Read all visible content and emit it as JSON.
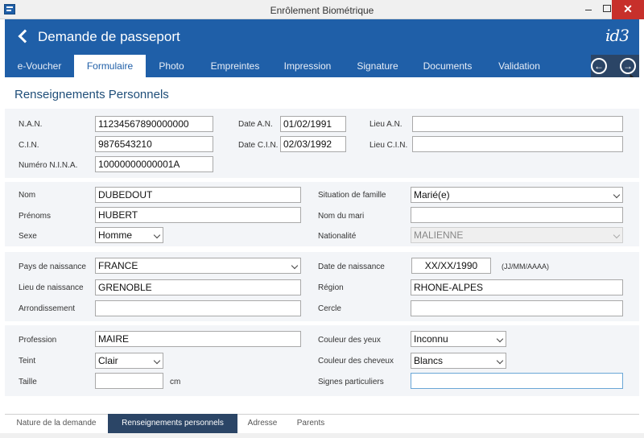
{
  "window": {
    "title": "Enrôlement Biométrique",
    "close_glyph": "✕"
  },
  "header": {
    "title": "Demande de passeport",
    "logo": "id3"
  },
  "tabs": [
    "e-Voucher",
    "Formulaire",
    "Photo",
    "Empreintes",
    "Impression",
    "Signature",
    "Documents",
    "Validation"
  ],
  "active_tab": "Formulaire",
  "nav": {
    "prev_glyph": "←",
    "next_glyph": "→"
  },
  "section_title": "Renseignements Personnels",
  "ids": {
    "nan": {
      "label": "N.A.N.",
      "value": "11234567890000000"
    },
    "cin": {
      "label": "C.I.N.",
      "value": "9876543210"
    },
    "nina": {
      "label": "Numéro N.I.N.A.",
      "value": "10000000000001A"
    },
    "date_an": {
      "label": "Date A.N.",
      "value": "01/02/1991"
    },
    "date_cin": {
      "label": "Date C.I.N.",
      "value": "02/03/1992"
    },
    "lieu_an": {
      "label": "Lieu A.N.",
      "value": ""
    },
    "lieu_cin": {
      "label": "Lieu C.I.N.",
      "value": ""
    }
  },
  "identity": {
    "nom": {
      "label": "Nom",
      "value": "DUBEDOUT"
    },
    "prenoms": {
      "label": "Prénoms",
      "value": "HUBERT"
    },
    "sexe": {
      "label": "Sexe",
      "value": "Homme"
    },
    "situation": {
      "label": "Situation de famille",
      "value": "Marié(e)"
    },
    "nom_mari": {
      "label": "Nom du mari",
      "value": ""
    },
    "nationalite": {
      "label": "Nationalité",
      "value": "MALIENNE"
    }
  },
  "birth": {
    "pays": {
      "label": "Pays de naissance",
      "value": "FRANCE"
    },
    "lieu": {
      "label": "Lieu de naissance",
      "value": "GRENOBLE"
    },
    "arrondissement": {
      "label": "Arrondissement",
      "value": ""
    },
    "date": {
      "label": "Date de naissance",
      "value": "XX/XX/1990",
      "format_hint": "(JJ/MM/AAAA)"
    },
    "region": {
      "label": "Région",
      "value": "RHONE-ALPES"
    },
    "cercle": {
      "label": "Cercle",
      "value": ""
    }
  },
  "physical": {
    "profession": {
      "label": "Profession",
      "value": "MAIRE"
    },
    "teint": {
      "label": "Teint",
      "value": "Clair"
    },
    "taille": {
      "label": "Taille",
      "value": "",
      "unit": "cm"
    },
    "yeux": {
      "label": "Couleur des yeux",
      "value": "Inconnu"
    },
    "cheveux": {
      "label": "Couleur des cheveux",
      "value": "Blancs"
    },
    "signes": {
      "label": "Signes particuliers",
      "value": ""
    }
  },
  "bottom_tabs": [
    "Nature de la demande",
    "Renseignements personnels",
    "Adresse",
    "Parents"
  ],
  "active_bottom_tab": "Renseignements personnels"
}
